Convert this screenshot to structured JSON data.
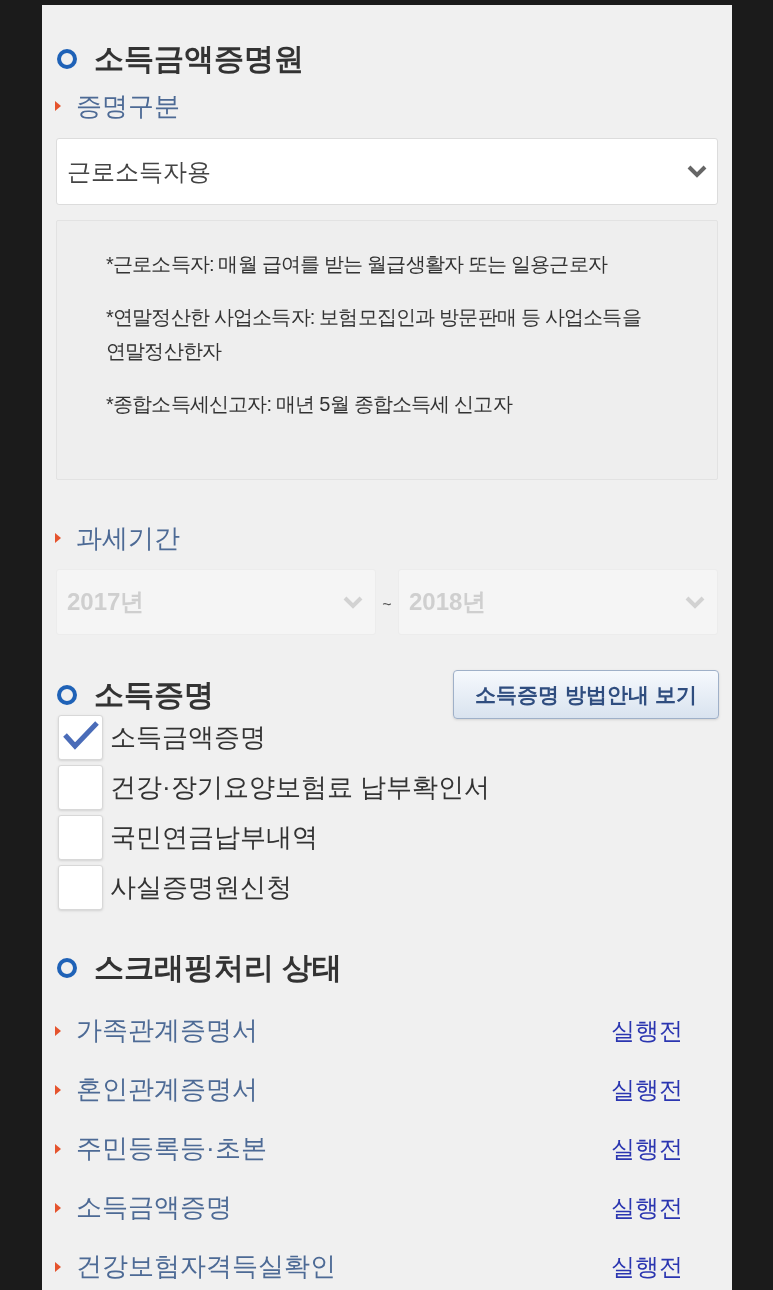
{
  "form": {
    "title": "소득금액증명원",
    "type_field": {
      "label": "증명구분",
      "value": "근로소득자용",
      "disabled": false
    },
    "notes": [
      "*근로소득자: 매월 급여를 받는 월급생활자 또는 일용근로자",
      "*연말정산한 사업소득자: 보험모집인과 방문판매 등 사업소득을 연말정산한자",
      "*종합소득세신고자: 매년 5월 종합소득세 신고자"
    ],
    "period": {
      "label": "과세기간",
      "from": {
        "value": "2017년",
        "disabled": true
      },
      "separator": "~",
      "to": {
        "value": "2018년",
        "disabled": true
      }
    }
  },
  "income_proof": {
    "title": "소득증명",
    "guide_button": "소득증명 방법안내 보기",
    "options": [
      {
        "label": "소득금액증명",
        "checked": true
      },
      {
        "label": "건강·장기요양보험료 납부확인서",
        "checked": false
      },
      {
        "label": "국민연금납부내역",
        "checked": false
      },
      {
        "label": "사실증명원신청",
        "checked": false
      }
    ]
  },
  "scraping": {
    "title": "스크래핑처리 상태",
    "items": [
      {
        "name": "가족관계증명서",
        "status": "실행전"
      },
      {
        "name": "혼인관계증명서",
        "status": "실행전"
      },
      {
        "name": "주민등록등·초본",
        "status": "실행전"
      },
      {
        "name": "소득금액증명",
        "status": "실행전"
      },
      {
        "name": "건강보험자격득실확인",
        "status": "실행전"
      }
    ]
  }
}
